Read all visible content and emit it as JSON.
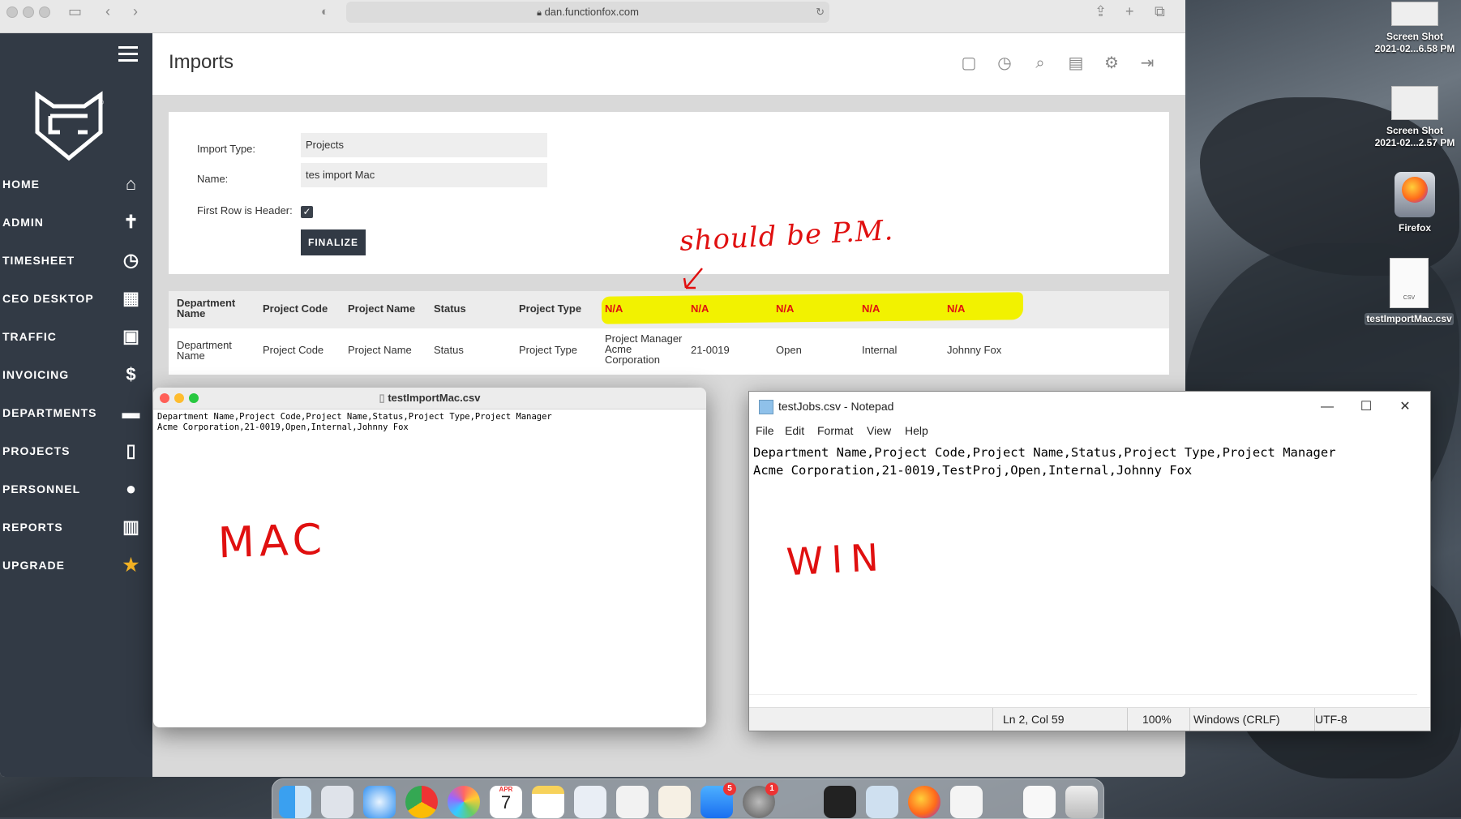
{
  "browser": {
    "url": "dan.functionfox.com"
  },
  "sidebar": {
    "items": [
      {
        "label": "HOME",
        "icon": "home-icon"
      },
      {
        "label": "ADMIN",
        "icon": "person-icon"
      },
      {
        "label": "TIMESHEET",
        "icon": "clock-icon"
      },
      {
        "label": "CEO DESKTOP",
        "icon": "dashboard-icon"
      },
      {
        "label": "TRAFFIC",
        "icon": "calendar-icon"
      },
      {
        "label": "INVOICING",
        "icon": "dollar-icon"
      },
      {
        "label": "DEPARTMENTS",
        "icon": "briefcase-icon"
      },
      {
        "label": "PROJECTS",
        "icon": "document-icon"
      },
      {
        "label": "PERSONNEL",
        "icon": "user-icon"
      },
      {
        "label": "REPORTS",
        "icon": "bar-chart-icon"
      },
      {
        "label": "UPGRADE",
        "icon": "star-icon"
      }
    ]
  },
  "page": {
    "title": "Imports"
  },
  "form": {
    "import_type_label": "Import Type:",
    "import_type_value": "Projects",
    "name_label": "Name:",
    "name_value": "tes import Mac",
    "first_row_label": "First Row is Header:",
    "first_row_checked": true,
    "finalize_label": "FINALIZE"
  },
  "table": {
    "headers": [
      "Department Name",
      "Project Code",
      "Project Name",
      "Status",
      "Project Type",
      "N/A",
      "N/A",
      "N/A",
      "N/A",
      "N/A"
    ],
    "row": [
      "Department Name",
      "Project Code",
      "Project Name",
      "Status",
      "Project Type",
      "Project Manager Acme Corporation",
      "21-0019",
      "Open",
      "Internal",
      "Johnny Fox"
    ]
  },
  "annotations": {
    "top": "should be P.M.",
    "mac": "MAC",
    "win": "WIN"
  },
  "mac_window": {
    "title": "testImportMac.csv",
    "line1": "Department Name,Project Code,Project Name,Status,Project Type,Project Manager",
    "line2": "Acme Corporation,21-0019,Open,Internal,Johnny Fox"
  },
  "notepad": {
    "title": "testJobs.csv - Notepad",
    "menu": [
      "File",
      "Edit",
      "Format",
      "View",
      "Help"
    ],
    "line1": "Department Name,Project Code,Project Name,Status,Project Type,Project Manager",
    "line2": "Acme Corporation,21-0019,TestProj,Open,Internal,Johnny Fox",
    "status_position": "Ln 2, Col 59",
    "status_zoom": "100%",
    "status_eol": "Windows (CRLF)",
    "status_encoding": "UTF-8"
  },
  "desktop": {
    "icons": [
      {
        "label1": "Screen Shot",
        "label2": "2021-02...6.58 PM"
      },
      {
        "label1": "Screen Shot",
        "label2": "2021-02...2.57 PM"
      },
      {
        "label1": "Firefox",
        "label2": ""
      },
      {
        "label1": "testImportMac.csv",
        "label2": ""
      }
    ],
    "csv_icon_text": "CSV"
  },
  "dock": {
    "calendar_month": "APR",
    "calendar_day": "7",
    "appstore_badge": "5",
    "settings_badge": "1"
  }
}
